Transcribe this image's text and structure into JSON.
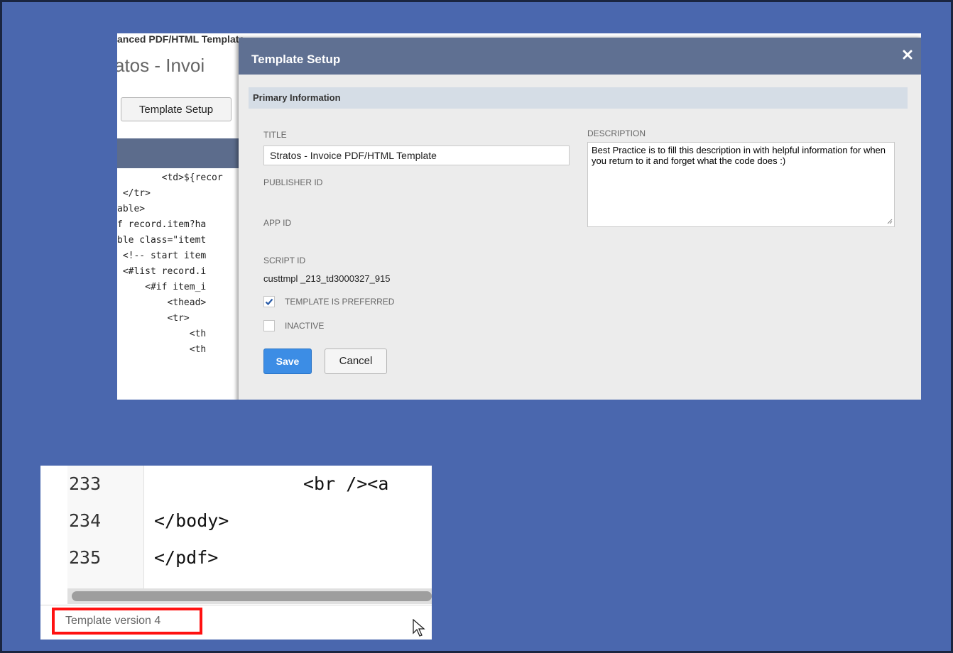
{
  "background_page": {
    "header_fragment": "anced PDF/HTML Template",
    "title_fragment": "atos - Invoi",
    "setup_button_label": "Template Setup",
    "code_lines": [
      "        <td>${recor",
      " </tr>",
      "able>",
      "f record.item?ha",
      "ble class=\"itemt",
      " <!-- start item",
      " <#list record.i",
      "     <#if item_i",
      "         <thead>",
      "         <tr>",
      "             <th",
      "             <th"
    ]
  },
  "modal": {
    "title": "Template Setup",
    "section_title": "Primary Information",
    "fields": {
      "title_label": "TITLE",
      "title_value": "Stratos - Invoice PDF/HTML Template",
      "publisher_id_label": "PUBLISHER ID",
      "app_id_label": "APP ID",
      "script_id_label": "SCRIPT ID",
      "script_id_value": "custtmpl _213_td3000327_915",
      "description_label": "DESCRIPTION",
      "description_value": "Best Practice is to fill this description in with helpful information for when you return to it and forget what the code does :)"
    },
    "checkboxes": [
      {
        "label": "TEMPLATE IS PREFERRED",
        "checked": true
      },
      {
        "label": "INACTIVE",
        "checked": false
      }
    ],
    "buttons": {
      "save": "Save",
      "cancel": "Cancel"
    }
  },
  "editor": {
    "lines": [
      {
        "number": "233",
        "code": "<br /><a"
      },
      {
        "number": "234",
        "code": "</body>"
      },
      {
        "number": "235",
        "code": "</pdf>"
      }
    ],
    "status_text": "Template version 4"
  },
  "colors": {
    "page_background": "#4a67ae",
    "modal_header": "#5f7092",
    "save_button": "#3c8de5",
    "highlight_box": "#ff1111"
  }
}
